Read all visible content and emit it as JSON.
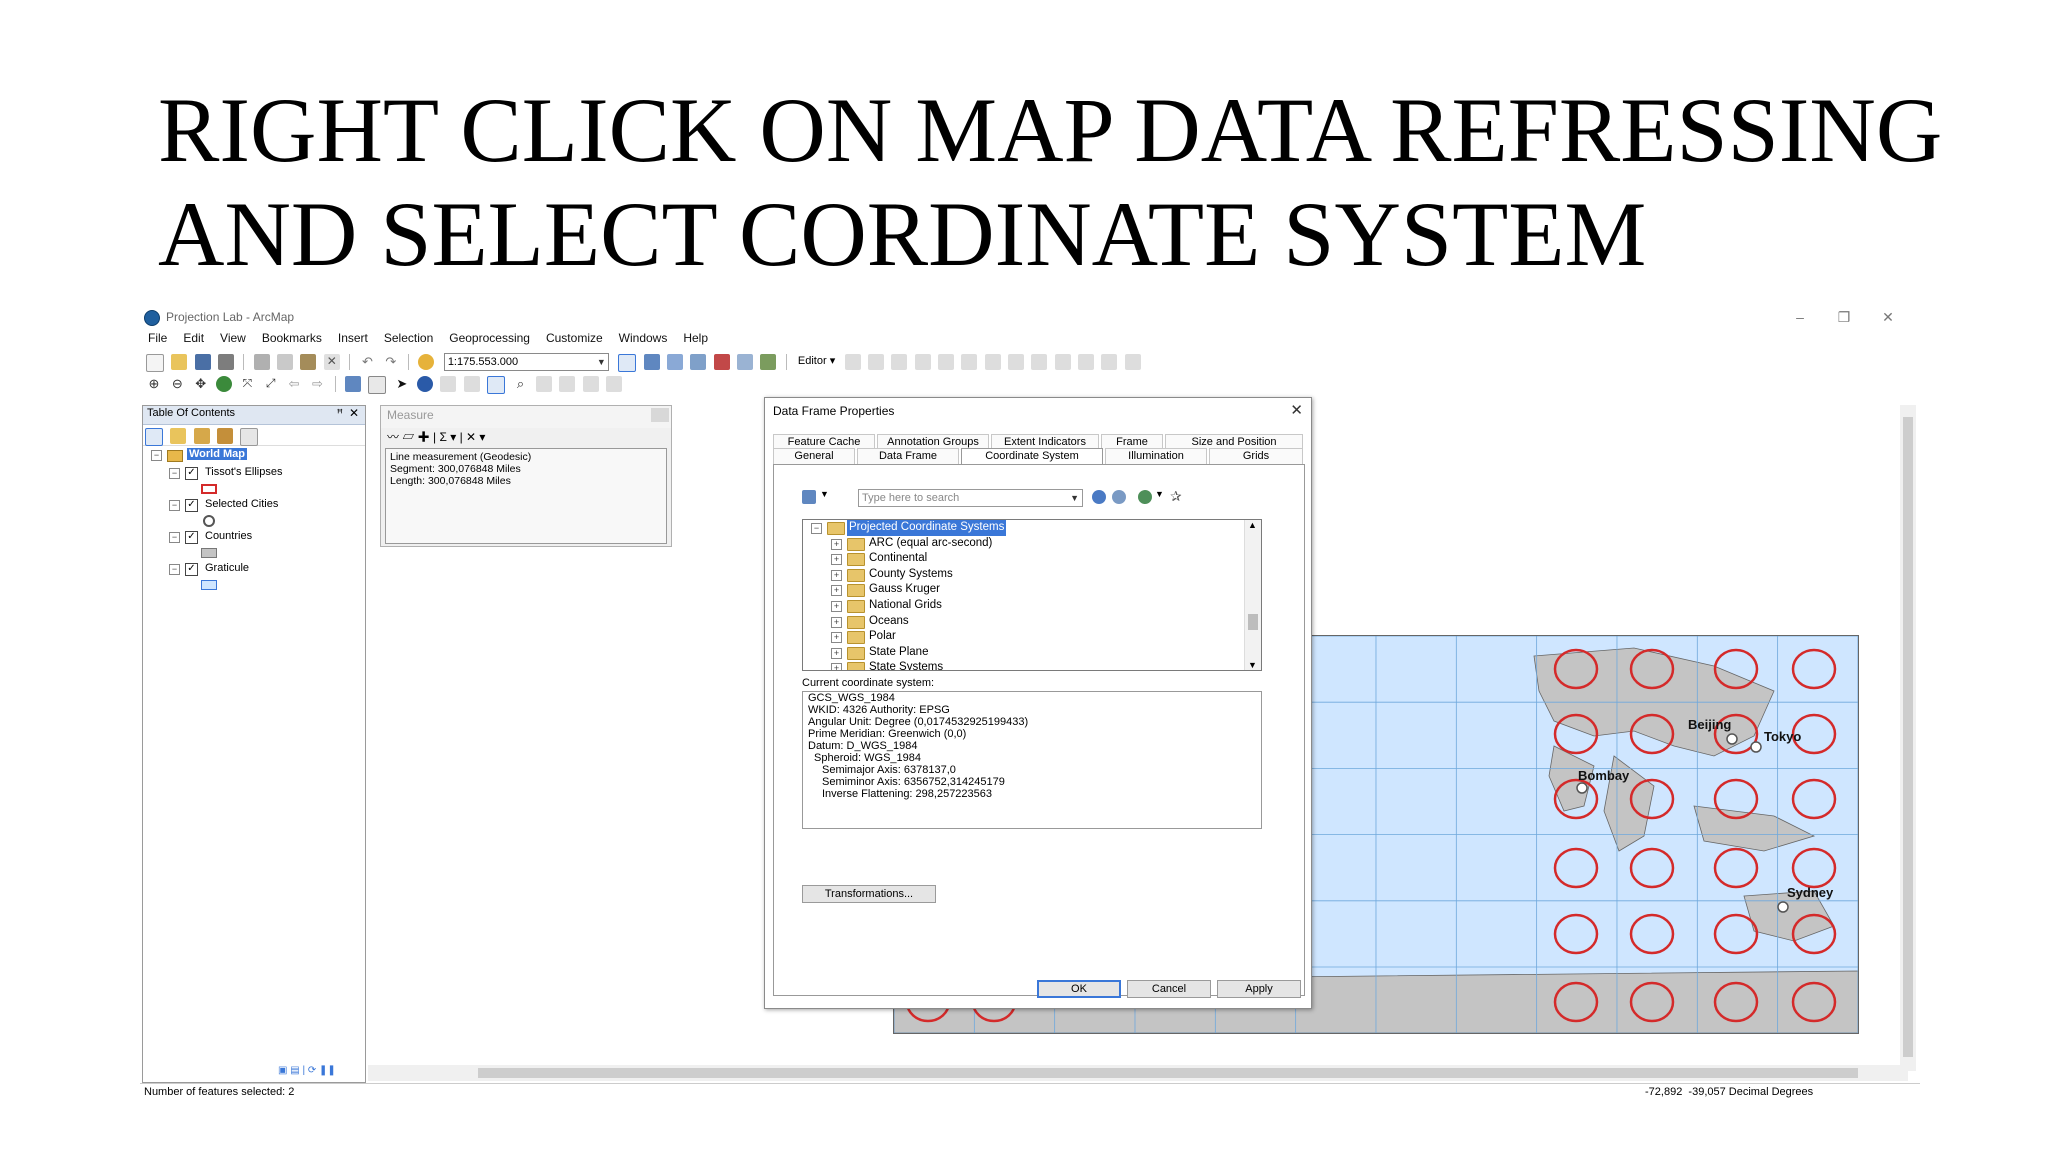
{
  "slide": {
    "title_line1": "RIGHT CLICK ON MAP DATA REFRESSING",
    "title_line2": "AND SELECT CORDINATE SYSTEM"
  },
  "window": {
    "title": "Projection Lab - ArcMap",
    "controls": {
      "minimize": "–",
      "restore": "❐",
      "close": "✕"
    }
  },
  "menu": [
    "File",
    "Edit",
    "View",
    "Bookmarks",
    "Insert",
    "Selection",
    "Geoprocessing",
    "Customize",
    "Windows",
    "Help"
  ],
  "toolbar": {
    "scale": "1:175.553.000",
    "editor": "Editor ▾"
  },
  "toc": {
    "title": "Table Of Contents",
    "pin": "ꟸ",
    "close": "✕",
    "frame": "World Map",
    "layers": [
      "Tissot's Ellipses",
      "Selected Cities",
      "Countries",
      "Graticule"
    ]
  },
  "measure": {
    "title": "Measure",
    "tools": "〰 ▱ ✚ | Σ ▾ | ✕ ▾",
    "lines": [
      "Line measurement (Geodesic)",
      "Segment: 300,076848 Miles",
      "Length: 300,076848 Miles"
    ]
  },
  "map": {
    "cities": [
      "Beijing",
      "Tokyo",
      "Bombay",
      "Sydney"
    ],
    "colors": {
      "ocean": "#cfe6ff",
      "land": "#c4c4c4",
      "ellipse": "#d42a2a",
      "grid": "#6fa8dc"
    }
  },
  "dialog": {
    "title": "Data Frame Properties",
    "close": "✕",
    "tabs_row1": [
      "Feature Cache",
      "Annotation Groups",
      "Extent Indicators",
      "Frame",
      "Size and Position"
    ],
    "tabs_row2": [
      "General",
      "Data Frame",
      "Coordinate System",
      "Illumination",
      "Grids"
    ],
    "search_placeholder": "Type here to search",
    "tree_root": "Projected Coordinate Systems",
    "tree_items": [
      "ARC (equal arc-second)",
      "Continental",
      "County Systems",
      "Gauss Kruger",
      "National Grids",
      "Oceans",
      "Polar",
      "State Plane",
      "State Systems"
    ],
    "current_label": "Current coordinate system:",
    "current_lines": [
      "GCS_WGS_1984",
      "WKID: 4326 Authority: EPSG",
      "",
      "Angular Unit: Degree (0,0174532925199433)",
      "Prime Meridian: Greenwich (0,0)",
      "Datum: D_WGS_1984",
      "Spheroid: WGS_1984",
      "Semimajor Axis: 6378137,0",
      "Semiminor Axis: 6356752,314245179",
      "Inverse Flattening: 298,257223563"
    ],
    "transformations": "Transformations...",
    "ok": "OK",
    "cancel": "Cancel",
    "apply": "Apply"
  },
  "status": {
    "left": "Number of features selected: 2",
    "right": "-72,892  -39,057 Decimal Degrees"
  }
}
